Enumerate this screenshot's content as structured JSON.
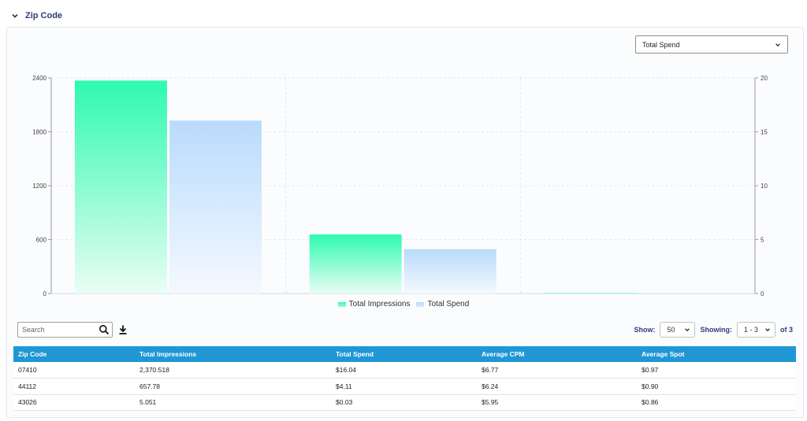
{
  "section": {
    "title": "Zip Code"
  },
  "metric_select": {
    "selected": "Total Spend"
  },
  "chart_data": {
    "type": "bar",
    "categories": [
      "07410",
      "44112",
      "43026"
    ],
    "series": [
      {
        "name": "Total Impressions",
        "values": [
          2370.518,
          657.78,
          5.051
        ],
        "axis": "left",
        "color_top": "#2efab0",
        "color_bottom": "#eafdf5"
      },
      {
        "name": "Total Spend",
        "values": [
          16.04,
          4.11,
          0.03
        ],
        "axis": "right",
        "color_top": "#b9dbfb",
        "color_bottom": "#f4f9fe"
      }
    ],
    "y_left": {
      "ticks": [
        "2400",
        "1800",
        "1200",
        "600",
        "0"
      ],
      "ylim": [
        0,
        2400
      ]
    },
    "y_right": {
      "ticks": [
        "20",
        "15",
        "10",
        "5",
        "0"
      ],
      "ylim": [
        0,
        20
      ]
    },
    "grid": true,
    "legend_position": "bottom"
  },
  "toolbar": {
    "search_placeholder": "Search",
    "show_label": "Show:",
    "show_value": "50",
    "showing_label": "Showing:",
    "showing_value": "1 - 3",
    "of_label": "of 3"
  },
  "table": {
    "headers": [
      "Zip Code",
      "Total Impressions",
      "Total Spend",
      "Average CPM",
      "Average Spot"
    ],
    "rows": [
      [
        "07410",
        "2,370.518",
        "$16.04",
        "$6.77",
        "$0.97"
      ],
      [
        "44112",
        "657.78",
        "$4.11",
        "$6.24",
        "$0.90"
      ],
      [
        "43026",
        "5.051",
        "$0.03",
        "$5.95",
        "$0.86"
      ]
    ]
  }
}
